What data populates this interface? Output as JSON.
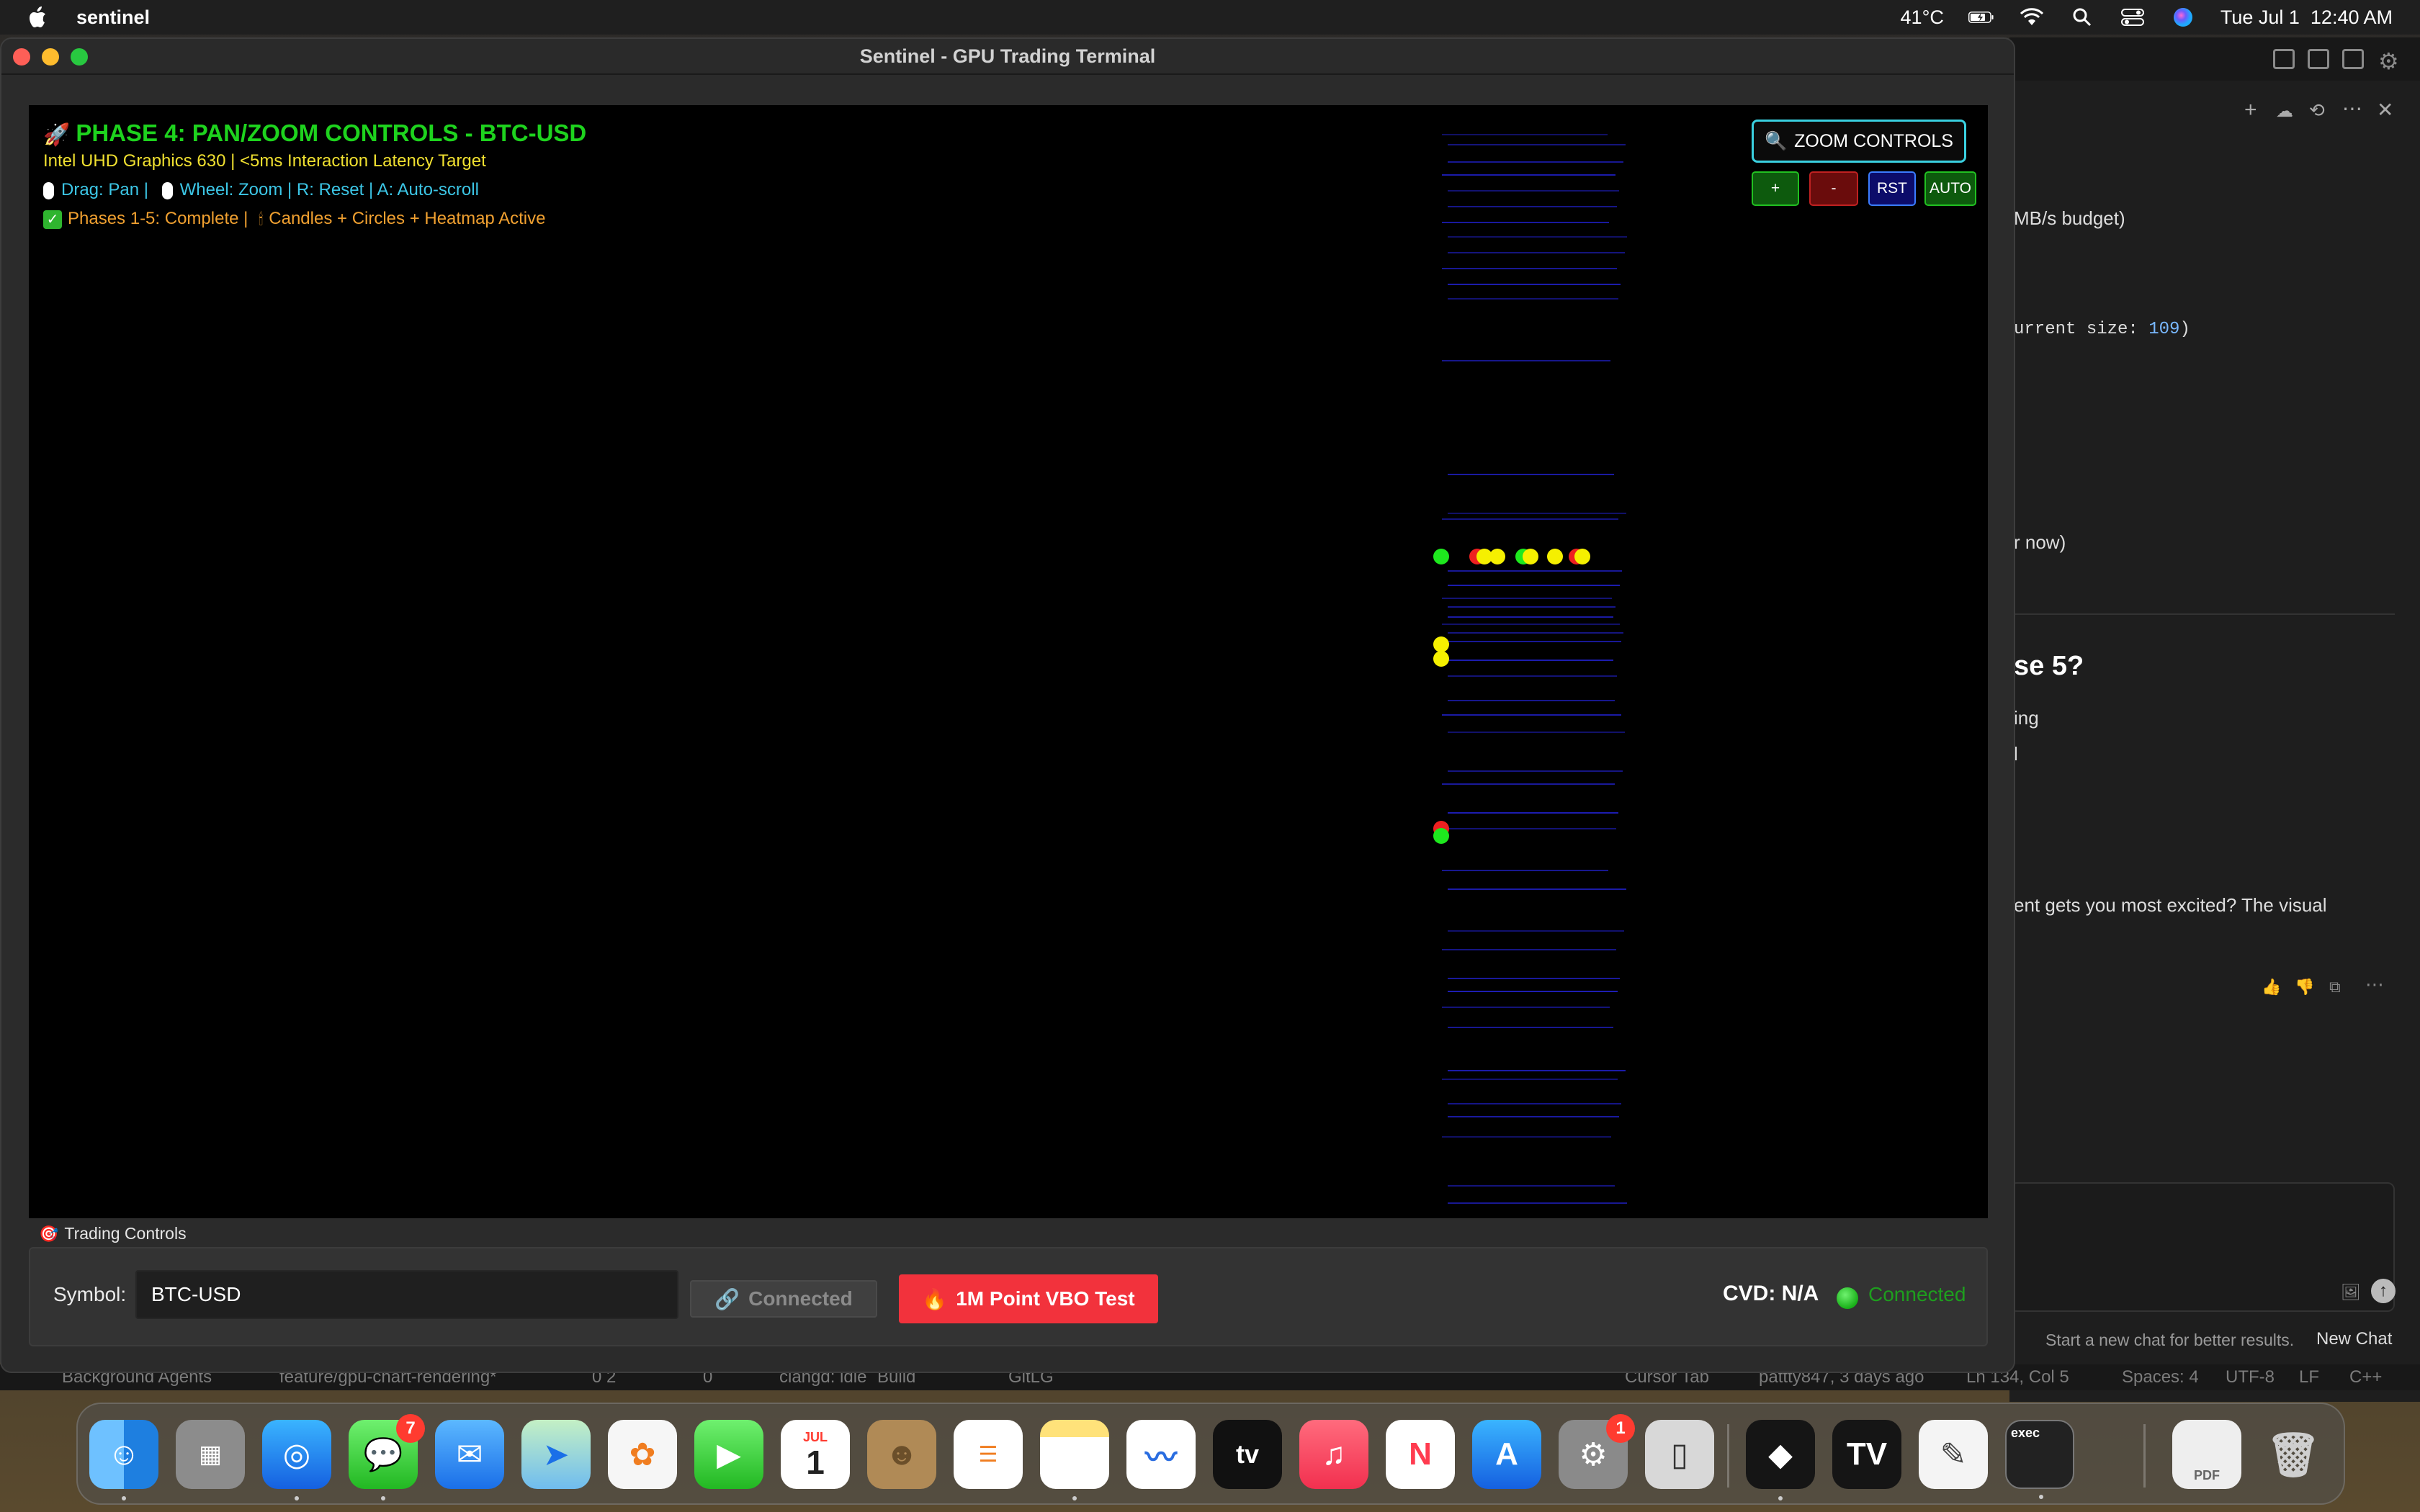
{
  "menubar": {
    "app_name": "sentinel",
    "temperature": "41°C",
    "datetime": "Tue Jul 1  12:40 AM"
  },
  "window": {
    "title": "Sentinel - GPU Trading Terminal"
  },
  "chart_overlay": {
    "title": "PHASE 4: PAN/ZOOM CONTROLS - BTC-USD",
    "gpu_line": "Intel UHD Graphics 630 | <5ms Interaction Latency Target",
    "help_drag": "Drag: Pan |",
    "help_rest": "Wheel: Zoom | R: Reset | A: Auto-scroll",
    "phase_line_a": "Phases 1-5: Complete |",
    "phase_line_b": "Candles + Circles + Heatmap Active",
    "zoom_controls_label": "ZOOM CONTROLS",
    "zoom_buttons": {
      "plus": "+",
      "minus": "-",
      "reset": "RST",
      "auto": "AUTO"
    },
    "colors": {
      "title": "#1ed31e",
      "gpu": "#f0e030",
      "help": "#3cc6e6",
      "phase": "#f0a030",
      "heatmap": "#1d1db5",
      "buy_dot": "#1ee81e",
      "sell_dot": "#ee2020",
      "mixed_dot": "#f5f000"
    }
  },
  "trading_controls": {
    "section_label": "Trading Controls",
    "symbol_label": "Symbol:",
    "symbol_value": "BTC-USD",
    "connect_button": "Connected",
    "vbo_button": "1M Point VBO Test",
    "cvd_label": "CVD: N/A",
    "status_text": "Connected"
  },
  "side_panel": {
    "line1": "MB/s budget)",
    "line2_code": "urrent size: ",
    "line2_num": "109",
    "line2_end": ")",
    "line3": "r now)",
    "heading": "se 5?",
    "line4": "ing",
    "line5": "l",
    "line6": "ent gets you most excited? The visual",
    "footer_hint": "Start a new chat for better results.",
    "new_chat": "New Chat"
  },
  "statusbar": {
    "background_agents": "Background Agents",
    "branch": "feature/gpu-chart-rendering*",
    "problems": "0  2",
    "ports": "0",
    "lang_server": "clangd: idle",
    "build": "Build",
    "gitlg": "GitLG",
    "cursor_tab": "Cursor Tab",
    "blame": "pattty847, 3 days ago",
    "position": "Ln 134, Col 5",
    "spaces": "Spaces: 4",
    "encoding": "UTF-8",
    "eol": "LF",
    "language": "C++"
  },
  "dock": {
    "calendar_month": "JUL",
    "calendar_day": "1",
    "messages_badge": "7",
    "settings_badge": "1",
    "tv_label": "tv",
    "terminal_label": "exec",
    "pdf_label": "PDF"
  }
}
